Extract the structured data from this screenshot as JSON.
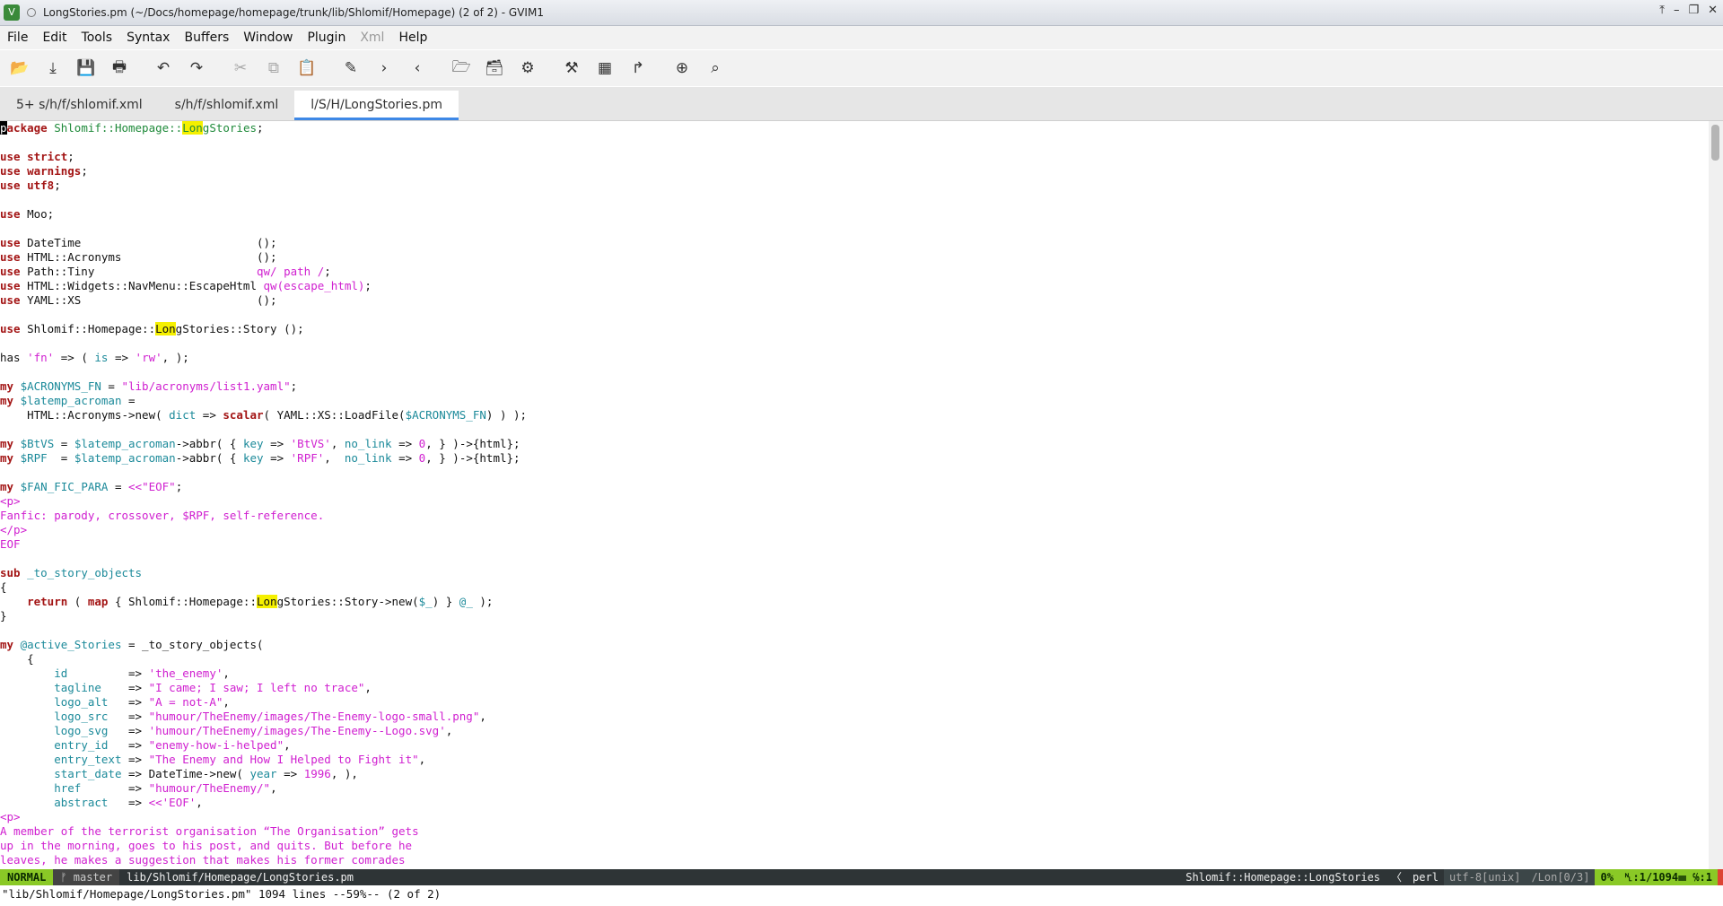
{
  "window": {
    "title": "LongStories.pm (~/Docs/homepage/homepage/trunk/lib/Shlomif/Homepage) (2 of 2) - GVIM1",
    "icon": "vim-icon"
  },
  "menu": [
    "File",
    "Edit",
    "Tools",
    "Syntax",
    "Buffers",
    "Window",
    "Plugin",
    "Xml",
    "Help"
  ],
  "toolbar": [
    {
      "name": "open-icon",
      "glyph": "📂"
    },
    {
      "name": "save-download-icon",
      "glyph": "⤓"
    },
    {
      "name": "save-icon",
      "glyph": "💾"
    },
    {
      "name": "print-icon",
      "glyph": "🖶"
    },
    {
      "name": "undo-icon",
      "glyph": "↶"
    },
    {
      "name": "redo-icon",
      "glyph": "↷"
    },
    {
      "name": "cut-icon",
      "glyph": "✂"
    },
    {
      "name": "copy-icon",
      "glyph": "⧉"
    },
    {
      "name": "paste-icon",
      "glyph": "📋"
    },
    {
      "name": "replace-icon",
      "glyph": "✎"
    },
    {
      "name": "find-next-icon",
      "glyph": "›"
    },
    {
      "name": "find-prev-icon",
      "glyph": "‹"
    },
    {
      "name": "load-session-icon",
      "glyph": "🗁"
    },
    {
      "name": "save-session-icon",
      "glyph": "🗃"
    },
    {
      "name": "run-script-icon",
      "glyph": "⚙"
    },
    {
      "name": "make-icon",
      "glyph": "⚒"
    },
    {
      "name": "shell-icon",
      "glyph": "▦"
    },
    {
      "name": "tags-jump-icon",
      "glyph": "↱"
    },
    {
      "name": "help-icon",
      "glyph": "⊕"
    },
    {
      "name": "find-help-icon",
      "glyph": "⌕"
    }
  ],
  "tabs": [
    {
      "label": "5+ s/h/f/shlomif.xml",
      "active": false
    },
    {
      "label": "s/h/f/shlomif.xml",
      "active": false
    },
    {
      "label": "l/S/H/LongStories.pm",
      "active": true
    }
  ],
  "statusline": {
    "mode": "NORMAL",
    "branch": "ᚠ master",
    "file": "lib/Shlomif/Homepage/LongStories.pm",
    "package": "Shlomif::Homepage::LongStories",
    "sep": "〈",
    "filetype": "perl",
    "encoding": "utf-8[unix]",
    "lon": "/Lon[0/3]",
    "percent": "0%",
    "position": "␤:1/1094☰ ℅:1"
  },
  "message": "\"lib/Shlomif/Homepage/LongStories.pm\" 1094 lines --59%-- (2 of 2)"
}
